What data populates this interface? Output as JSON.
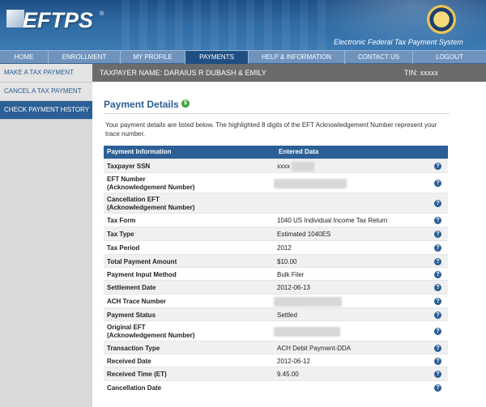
{
  "header": {
    "logo": "EFTPS",
    "logo_mark": "®",
    "system_name": "Electronic Federal Tax Payment System"
  },
  "nav": [
    {
      "label": "HOME",
      "active": false
    },
    {
      "label": "ENROLLMENT",
      "active": false
    },
    {
      "label": "MY PROFILE",
      "active": false
    },
    {
      "label": "PAYMENTS",
      "active": true
    },
    {
      "label": "HELP & INFORMATION",
      "active": false
    },
    {
      "label": "CONTACT US",
      "active": false
    },
    {
      "label": "LOGOUT",
      "active": false
    }
  ],
  "sidebar": [
    {
      "label": "MAKE A TAX PAYMENT",
      "active": false
    },
    {
      "label": "CANCEL A TAX PAYMENT",
      "active": false
    },
    {
      "label": "CHECK PAYMENT HISTORY",
      "active": true
    }
  ],
  "taxpayer": {
    "name": "TAXPAYER NAME: DARAIUS R DUBASH & EMILY",
    "tin": "TIN: xxxxx"
  },
  "page": {
    "title": "Payment Details",
    "title_icon": "$",
    "intro": "Your payment details are listed below. The highlighted 8 digits of the EFT Acknowledgement Number represent your trace number."
  },
  "table": {
    "col1": "Payment Information",
    "col2": "Entered Data",
    "help_glyph": "?",
    "rows": [
      {
        "label": "Taxpayer SSN",
        "value": "xxxx"
      },
      {
        "label": "EFT Number\n(Acknowledgement Number)",
        "value": ""
      },
      {
        "label": "Cancellation EFT\n(Acknowledgement Number)",
        "value": ""
      },
      {
        "label": "Tax Form",
        "value": "1040 US Individual Income Tax Return"
      },
      {
        "label": "Tax Type",
        "value": "Estimated 1040ES"
      },
      {
        "label": "Tax Period",
        "value": "2012"
      },
      {
        "label": "Total Payment Amount",
        "value": "$10.00"
      },
      {
        "label": "Payment Input Method",
        "value": "Bulk Filer"
      },
      {
        "label": "Settlement Date",
        "value": "2012-06-13"
      },
      {
        "label": "ACH Trace Number",
        "value": ""
      },
      {
        "label": "Payment Status",
        "value": "Settled"
      },
      {
        "label": "Original EFT\n(Acknowledgement Number)",
        "value": ""
      },
      {
        "label": "Transaction Type",
        "value": "ACH Debit Payment-DDA"
      },
      {
        "label": "Received Date",
        "value": "2012-06-12"
      },
      {
        "label": "Received Time (ET)",
        "value": "9.45.00"
      },
      {
        "label": "Cancellation Date",
        "value": ""
      }
    ]
  },
  "colors": {
    "brand_blue": "#2b5f95",
    "nav_blue": "#6e93bd",
    "taxbar_gray": "#6b6b6b",
    "icon_green": "#3fa33a"
  }
}
